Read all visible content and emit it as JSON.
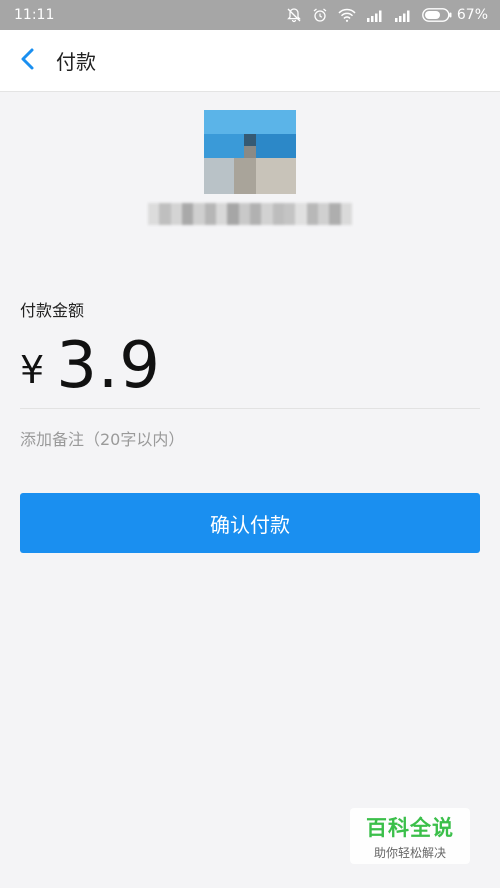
{
  "status_bar": {
    "time": "11:11",
    "battery": "67%"
  },
  "app_bar": {
    "title": "付款"
  },
  "payment": {
    "amount_label": "付款金额",
    "currency": "¥",
    "amount": "3.9",
    "note_placeholder": "添加备注（20字以内）",
    "confirm_label": "确认付款"
  },
  "watermark": {
    "title": "百科全说",
    "subtitle": "助你轻松解决"
  },
  "colors": {
    "accent": "#1a8ff0",
    "status_bar": "#a6a6a6",
    "watermark_green": "#3bbf4a"
  }
}
